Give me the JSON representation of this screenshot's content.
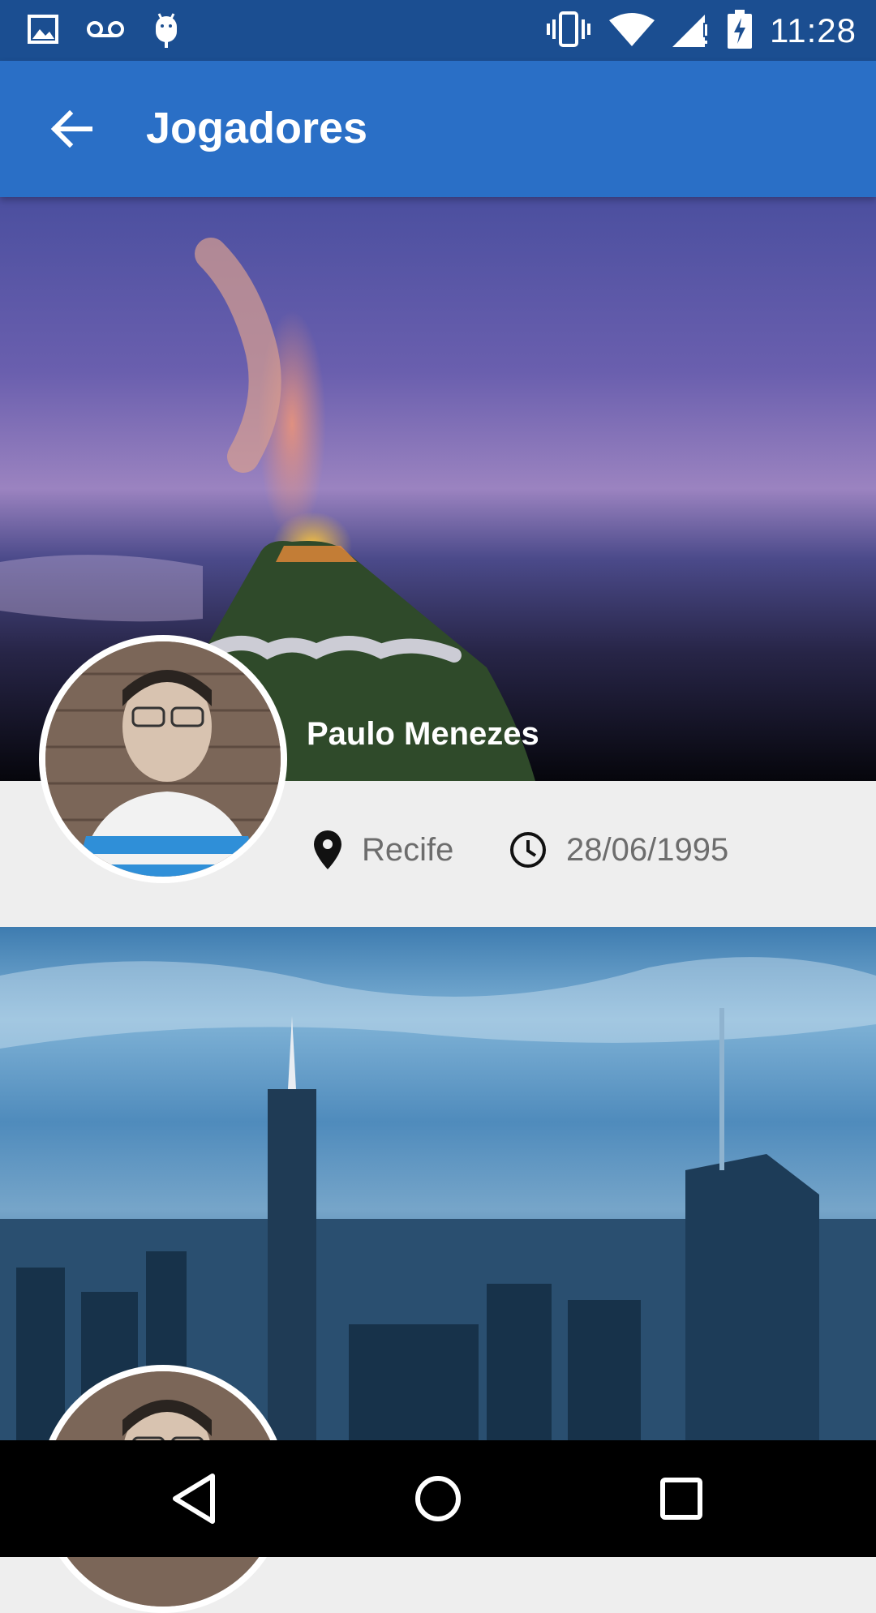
{
  "status_bar": {
    "time": "11:28",
    "left_icons": [
      "image-icon",
      "voicemail-icon",
      "android-debug-icon"
    ],
    "right_icons": [
      "vibrate-icon",
      "wifi-icon",
      "signal-icon",
      "battery-charging-icon"
    ]
  },
  "app_bar": {
    "title": "Jogadores",
    "back_icon": "arrow-back-icon"
  },
  "players": [
    {
      "name": "Paulo Menezes",
      "city": "Recife",
      "birth_date": "28/06/1995",
      "location_icon": "location-pin-icon",
      "date_icon": "clock-icon"
    }
  ],
  "nav_bar": {
    "buttons": [
      "back-triangle-icon",
      "home-circle-icon",
      "recents-square-icon"
    ]
  },
  "colors": {
    "status_bar": "#1b4e91",
    "app_bar": "#2a6fc6",
    "background": "#eeeeee",
    "meta_text": "#6d6d6d"
  }
}
